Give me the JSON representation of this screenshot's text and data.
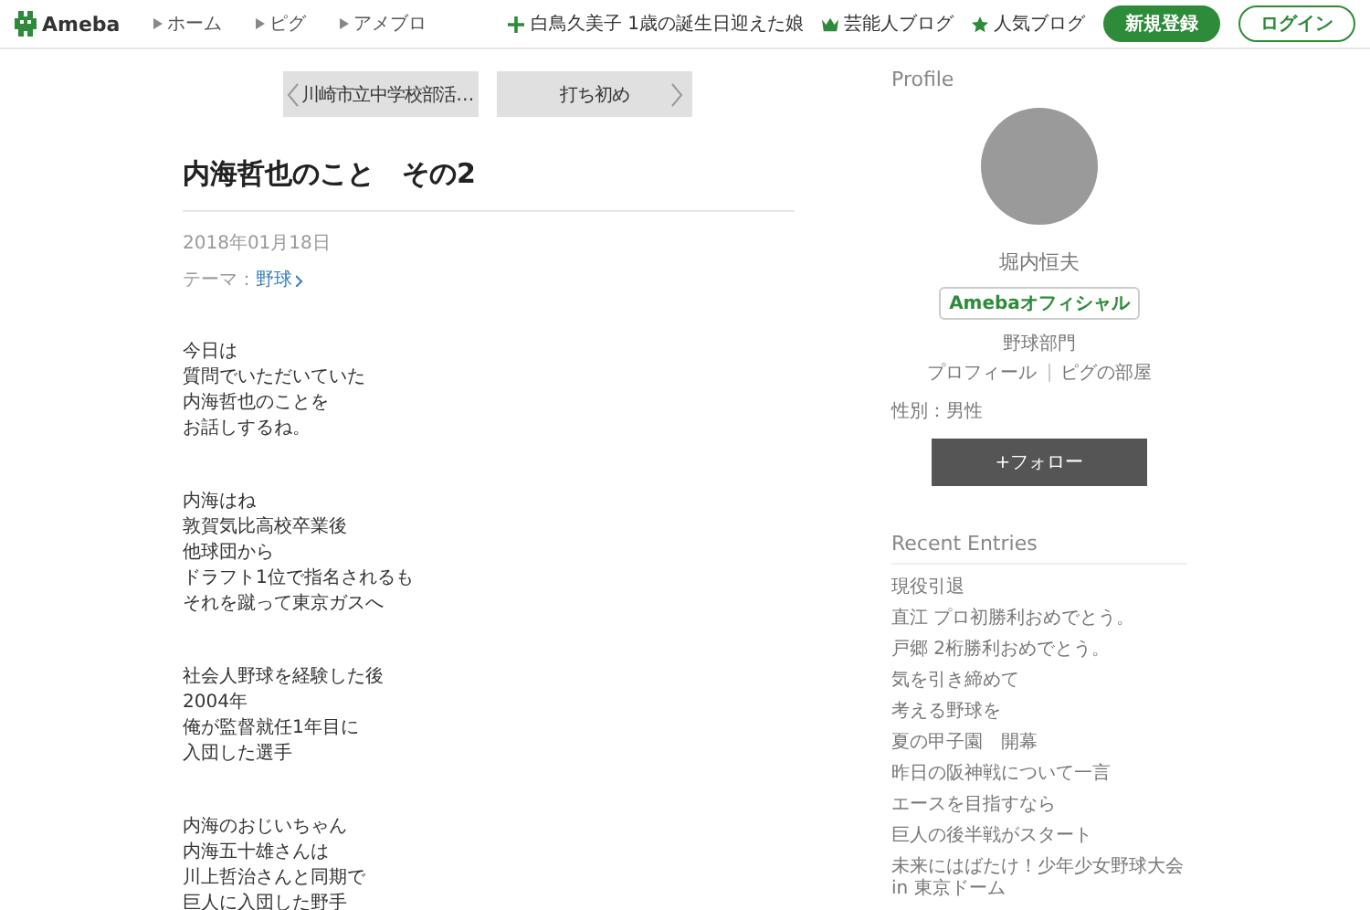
{
  "header": {
    "logo": "Ameba",
    "nav": [
      "ホーム",
      "ピグ",
      "アメブロ"
    ],
    "links": [
      {
        "kind": "plus",
        "label": "白鳥久美子 1歳の誕生日迎えた娘"
      },
      {
        "kind": "crown",
        "label": "芸能人ブログ"
      },
      {
        "kind": "star",
        "label": "人気ブログ"
      }
    ],
    "register_button": "新規登録",
    "login_button": "ログイン"
  },
  "pager": {
    "previous": "川崎市立中学校部活…",
    "next": "打ち初め"
  },
  "article": {
    "title": "内海哲也のこと　その2",
    "date": "2018年01月18日",
    "theme_label": "テーマ：",
    "theme": "野球",
    "paragraphs": [
      [
        "今日は",
        "質問でいただいていた",
        "内海哲也のことを",
        "お話しするね。"
      ],
      [
        "内海はね",
        "敦賀気比高校卒業後",
        "他球団から",
        "ドラフト1位で指名されるも",
        "それを蹴って東京ガスへ"
      ],
      [
        "社会人野球を経験した後",
        "2004年",
        "俺が監督就任1年目に",
        "入団した選手"
      ],
      [
        "内海のおじいちゃん",
        "内海五十雄さんは",
        "川上哲治さんと同期で",
        "巨人に入団した野手"
      ]
    ]
  },
  "profile": {
    "heading": "Profile",
    "name": "堀内恒夫",
    "badge": "Amebaオフィシャル",
    "category": "野球部門",
    "links": [
      "プロフィール",
      "ピグの部屋"
    ],
    "gender": "性別：男性",
    "follow_button": "+フォロー"
  },
  "recent_entries": {
    "heading": "Recent Entries",
    "items": [
      "現役引退",
      "直江 プロ初勝利おめでとう。",
      "戸郷 2桁勝利おめでとう。",
      "気を引き締めて",
      "考える野球を",
      "夏の甲子園　開幕",
      "昨日の阪神戦について一言",
      "エースを目指すなら",
      "巨人の後半戦がスタート",
      "未来にはばたけ！少年少女野球大会 in 東京ドーム"
    ]
  }
}
